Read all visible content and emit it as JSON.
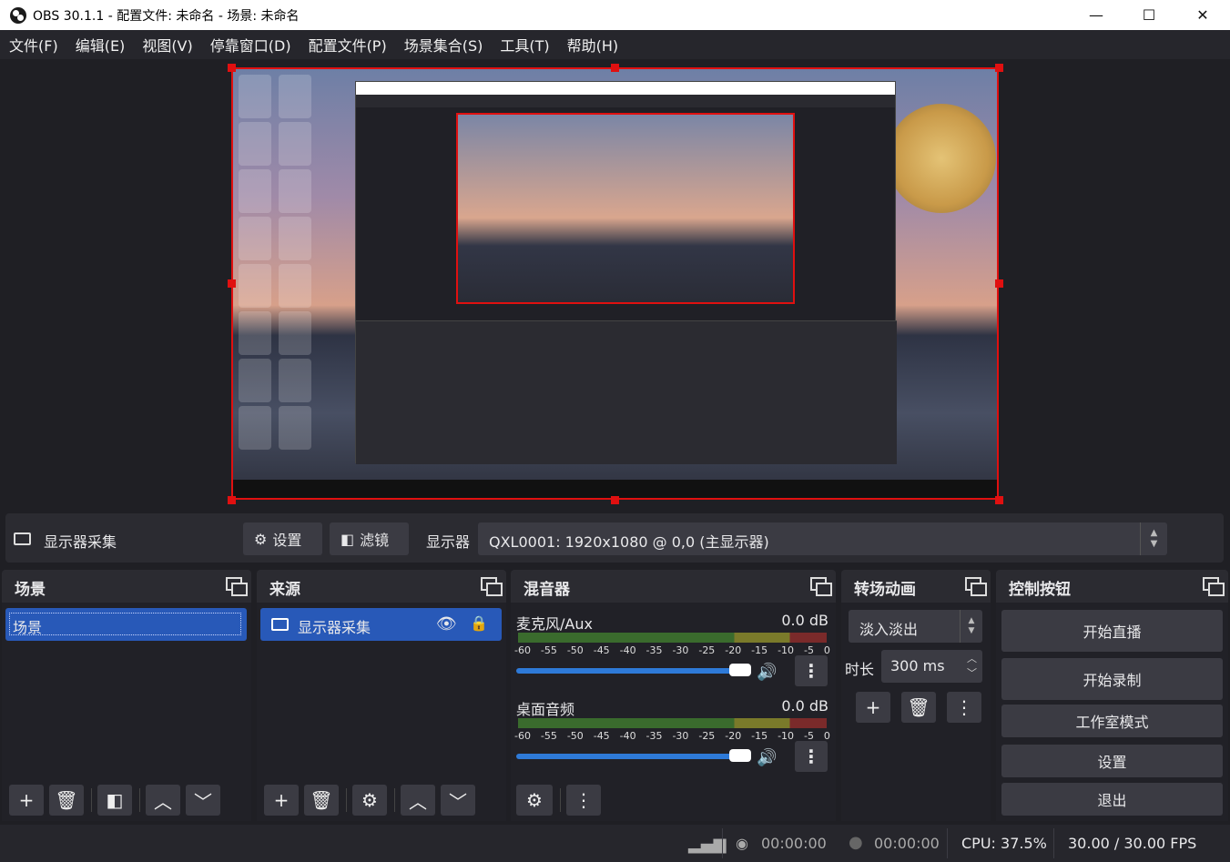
{
  "window": {
    "title": "OBS 30.1.1 - 配置文件: 未命名 - 场景: 未命名",
    "minimize_glyph": "—",
    "maximize_glyph": "☐",
    "close_glyph": "✕"
  },
  "menu": {
    "items": [
      "文件(F)",
      "编辑(E)",
      "视图(V)",
      "停靠窗口(D)",
      "配置文件(P)",
      "场景集合(S)",
      "工具(T)",
      "帮助(H)"
    ]
  },
  "source_toolbar": {
    "source_name": "显示器采集",
    "properties_label": "设置",
    "filters_label": "滤镜",
    "display_label": "显示器",
    "display_value": "QXL0001: 1920x1080 @ 0,0 (主显示器)"
  },
  "scenes": {
    "title": "场景",
    "items": [
      "场景"
    ]
  },
  "sources": {
    "title": "来源",
    "items": [
      "显示器采集"
    ]
  },
  "mixer": {
    "title": "混音器",
    "scale": [
      "-60",
      "-55",
      "-50",
      "-45",
      "-40",
      "-35",
      "-30",
      "-25",
      "-20",
      "-15",
      "-10",
      "-5",
      "0"
    ],
    "channels": [
      {
        "name": "麦克风/Aux",
        "db": "0.0 dB",
        "volume_fraction": 0.95
      },
      {
        "name": "桌面音频",
        "db": "0.0 dB",
        "volume_fraction": 0.95
      }
    ]
  },
  "transitions": {
    "title": "转场动画",
    "selected": "淡入淡出",
    "duration_label": "时长",
    "duration_value": "300 ms"
  },
  "controls": {
    "title": "控制按钮",
    "start_streaming": "开始直播",
    "start_recording": "开始录制",
    "studio_mode": "工作室模式",
    "settings": "设置",
    "exit": "退出"
  },
  "status": {
    "stream_time": "00:00:00",
    "record_time": "00:00:00",
    "cpu": "CPU: 37.5%",
    "fps": "30.00 / 30.00 FPS"
  },
  "colors": {
    "accent": "#2859b8",
    "selection": "#e01010",
    "panel": "#2b2b31",
    "background": "#1f1f24"
  }
}
